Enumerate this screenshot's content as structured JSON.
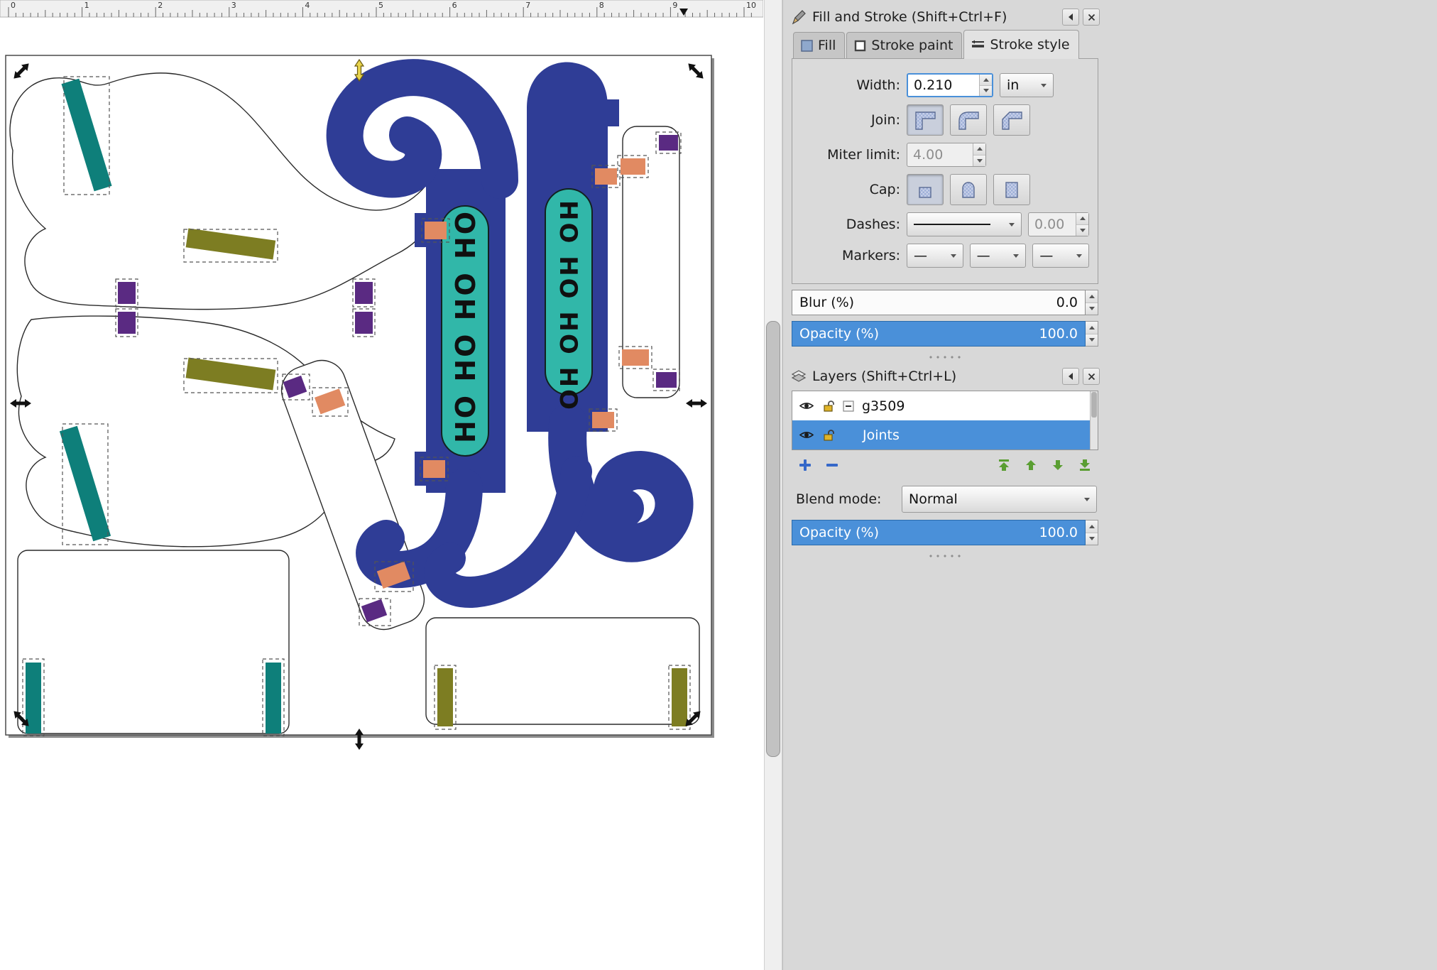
{
  "colors": {
    "accent": "#4a90d9",
    "design_blue": "#2f3d96",
    "teal": "#0e7f7a",
    "capsule": "#31b7a9",
    "olive": "#7d7d22",
    "purple": "#5a2a82",
    "salmon": "#e18a62",
    "handle_yellow": "#e8d44d",
    "panel_bg": "#d8d8d8"
  },
  "ruler": {
    "unit_marks": [
      "0",
      "1",
      "2",
      "3",
      "4",
      "5",
      "6",
      "7",
      "8",
      "9",
      "10"
    ]
  },
  "canvas": {
    "ho_text": "HO HO HO HO"
  },
  "fill_stroke": {
    "title": "Fill and Stroke (Shift+Ctrl+F)",
    "tabs": {
      "fill": "Fill",
      "stroke_paint": "Stroke paint",
      "stroke_style": "Stroke style"
    },
    "width": {
      "label": "Width:",
      "value": "0.210",
      "unit": "in"
    },
    "join_label": "Join:",
    "miter": {
      "label": "Miter limit:",
      "value": "4.00"
    },
    "cap_label": "Cap:",
    "dashes": {
      "label": "Dashes:",
      "offset": "0.00"
    },
    "markers": {
      "label": "Markers:",
      "start": "—",
      "mid": "—",
      "end": "—"
    },
    "blur": {
      "label": "Blur (%)",
      "value": "0.0"
    },
    "opacity": {
      "label": "Opacity (%)",
      "value": "100.0"
    }
  },
  "layers_panel": {
    "title": "Layers (Shift+Ctrl+L)",
    "rows": [
      {
        "name": "g3509"
      },
      {
        "name": "Joints"
      }
    ],
    "blend": {
      "label": "Blend mode:",
      "value": "Normal"
    },
    "opacity": {
      "label": "Opacity (%)",
      "value": "100.0"
    }
  }
}
